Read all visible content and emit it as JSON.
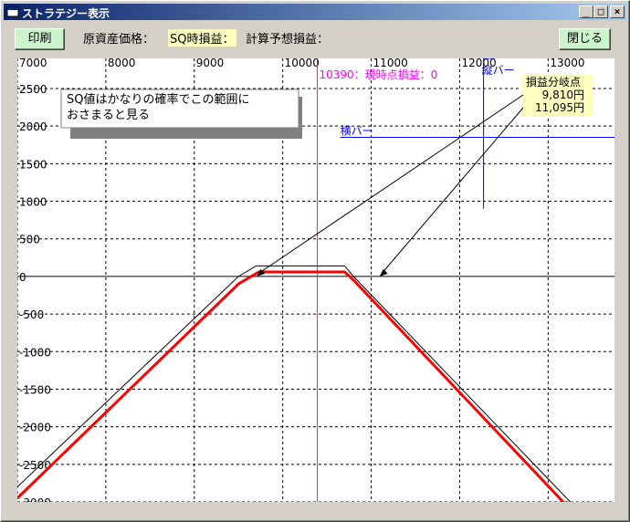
{
  "window": {
    "title": "ストラテジー表示",
    "controls": {
      "minimize": "_",
      "maximize": "□",
      "close": "×"
    }
  },
  "toolbar": {
    "print_label": "印刷",
    "close_label": "閉じる",
    "asset_price_label": "原資産価格：",
    "sq_pnl_label": "SQ時損益：",
    "calc_pnl_label": "計算予想損益："
  },
  "annotations": {
    "note": [
      "SQ値はかなりの確率でこの範囲に",
      "おさまると見る"
    ],
    "current_point_label": "10390：現時点損益：0",
    "vertical_bar_label": "縦バー",
    "horizontal_bar_label": "横バー",
    "breakeven_title": "損益分岐点",
    "breakeven_values": [
      "9,810円",
      "11,095円"
    ]
  },
  "colors": {
    "sq_line": "#ff0000",
    "current_line": "#000000",
    "current_price_line": "#ff00ff",
    "bar_lines": "#0000ff",
    "grid": "#000000",
    "breakeven_bg": "#ffffc0",
    "button_bg": "#cdf5cd"
  },
  "chart_data": {
    "type": "line",
    "x_ticks": [
      7000,
      8000,
      9000,
      10000,
      11000,
      12000,
      13000
    ],
    "y_ticks": [
      2500,
      2000,
      1500,
      1000,
      500,
      0,
      -500,
      -1000,
      -1500,
      -2000,
      -2500,
      -3000
    ],
    "xlim": [
      7000,
      13750
    ],
    "ylim": [
      -3000,
      2900
    ],
    "grid": true,
    "series": [
      {
        "x": [
          7000,
          9500,
          9700,
          10700,
          10800,
          13250
        ],
        "y": [
          -2800,
          0,
          140,
          140,
          0,
          -3000
        ]
      },
      {
        "x": [
          7000,
          9500,
          9730,
          10700,
          10800,
          13250
        ],
        "y": [
          -2950,
          -100,
          60,
          60,
          -50,
          -3100
        ]
      }
    ],
    "current_price": 10390,
    "current_pnl": 0,
    "breakeven": [
      9810,
      11095
    ],
    "note_range": [
      7000,
      9000
    ]
  }
}
